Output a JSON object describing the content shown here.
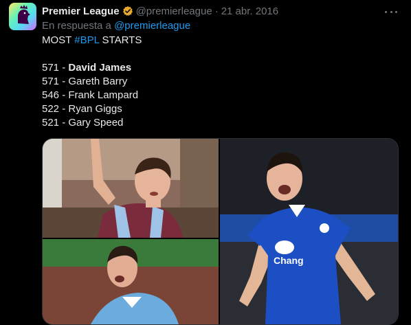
{
  "tweet": {
    "author_name": "Premier League",
    "handle": "@premierleague",
    "separator": "·",
    "date": "21 abr. 2016",
    "reply_prefix": "En respuesta a ",
    "reply_to": "@premierleague",
    "lines": {
      "l1_a": "MOST ",
      "l1_hashtag": "#BPL",
      "l1_b": " STARTS",
      "r1_num": "571 - ",
      "r1_name": "David James",
      "r2": "571 - Gareth Barry",
      "r3": "546 - Frank Lampard",
      "r4": "522 - Ryan Giggs",
      "r5": "521 - Gary Speed"
    }
  },
  "icons": {
    "avatar": "premier-league-lion-icon",
    "verified": "verified-badge-icon",
    "more": "more-options-icon"
  },
  "media": {
    "sponsor_text": "Chang"
  },
  "colors": {
    "background": "#000000",
    "text": "#e7e9ea",
    "muted": "#71767b",
    "link": "#1d9bf0",
    "verified": "#e8a92c",
    "everton_blue": "#1c4fc4",
    "villa_claret": "#7a2c3c",
    "city_sky": "#6cabdd"
  }
}
